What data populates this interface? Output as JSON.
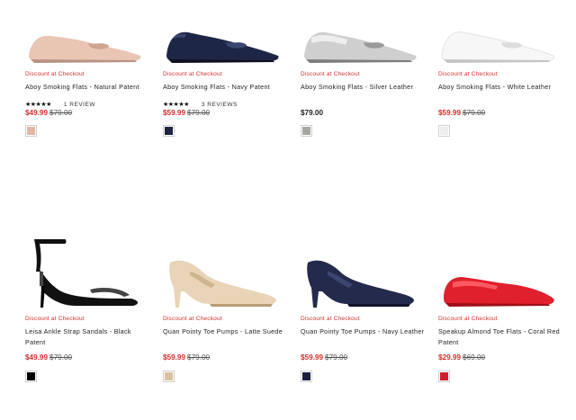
{
  "products": [
    {
      "promo": "Discount at Checkout",
      "name": "Aboy Smoking Flats - Natural Patent",
      "rating": {
        "stars": "★★★★★",
        "reviews": "1 REVIEW"
      },
      "price": {
        "sale": "$49.99",
        "original": "$79.00"
      },
      "swatch_color": "#e0b8a3",
      "image_icon": "flat-shoe-icon",
      "colors": {
        "shoe": "#e9c5b4",
        "shade": "#cfa590",
        "sole": "#b89282"
      }
    },
    {
      "promo": "Discount at Checkout",
      "name": "Aboy Smoking Flats - Navy Patent",
      "rating": {
        "stars": "★★★★★",
        "reviews": "3 REVIEWS"
      },
      "price": {
        "sale": "$59.99",
        "original": "$79.00"
      },
      "swatch_color": "#1e2442",
      "image_icon": "flat-shoe-icon",
      "colors": {
        "shoe": "#1e2646",
        "shade": "#3a4670",
        "sole": "#0d1020"
      }
    },
    {
      "promo": "Discount at Checkout",
      "name": "Aboy Smoking Flats - Silver Leather",
      "price": {
        "regular": "$79.00"
      },
      "swatch_color": "#a9a6a2",
      "image_icon": "flat-shoe-icon",
      "colors": {
        "shoe": "#cfcfcf",
        "shade": "#9a9a9a",
        "sole": "#7d7d7d"
      }
    },
    {
      "promo": "Discount at Checkout",
      "name": "Aboy Smoking Flats - White Leather",
      "price": {
        "sale": "$59.99",
        "original": "$79.00"
      },
      "swatch_color": "#eeeeee",
      "image_icon": "flat-shoe-icon",
      "colors": {
        "shoe": "#f7f7f7",
        "shade": "#dcdcdc",
        "sole": "#c4c4c4"
      }
    },
    {
      "promo": "Discount at Checkout",
      "name": "Leisa Ankle Strap Sandals - Black Patent",
      "price": {
        "sale": "$49.99",
        "original": "$79.00"
      },
      "swatch_color": "#000000",
      "image_icon": "sandal-icon",
      "colors": {
        "shoe": "#111111",
        "shade": "#444444",
        "sole": "#000000"
      }
    },
    {
      "promo": "Discount at Checkout",
      "name": "Quan Pointy Toe Pumps - Latte Suede",
      "price": {
        "sale": "$59.99",
        "original": "$79.00"
      },
      "swatch_color": "#d9c2a0",
      "image_icon": "pump-icon",
      "colors": {
        "shoe": "#e8d4b6",
        "shade": "#cdb58f",
        "sole": "#b89c76"
      }
    },
    {
      "promo": "Discount at Checkout",
      "name": "Quan Pointy Toe Pumps - Navy Leather",
      "price": {
        "sale": "$59.99",
        "original": "$79.00"
      },
      "swatch_color": "#1d2140",
      "image_icon": "pump-icon",
      "colors": {
        "shoe": "#232a4c",
        "shade": "#3c4670",
        "sole": "#10132a"
      }
    },
    {
      "promo": "Discount at Checkout",
      "name": "Speakup Almond Toe Flats - Coral Red Patent",
      "price": {
        "sale": "$29.99",
        "original": "$69.00"
      },
      "swatch_color": "#d01d2b",
      "image_icon": "flat-shoe-icon",
      "colors": {
        "shoe": "#e0202c",
        "shade": "#ff5a63",
        "sole": "#9e0f18"
      }
    }
  ]
}
